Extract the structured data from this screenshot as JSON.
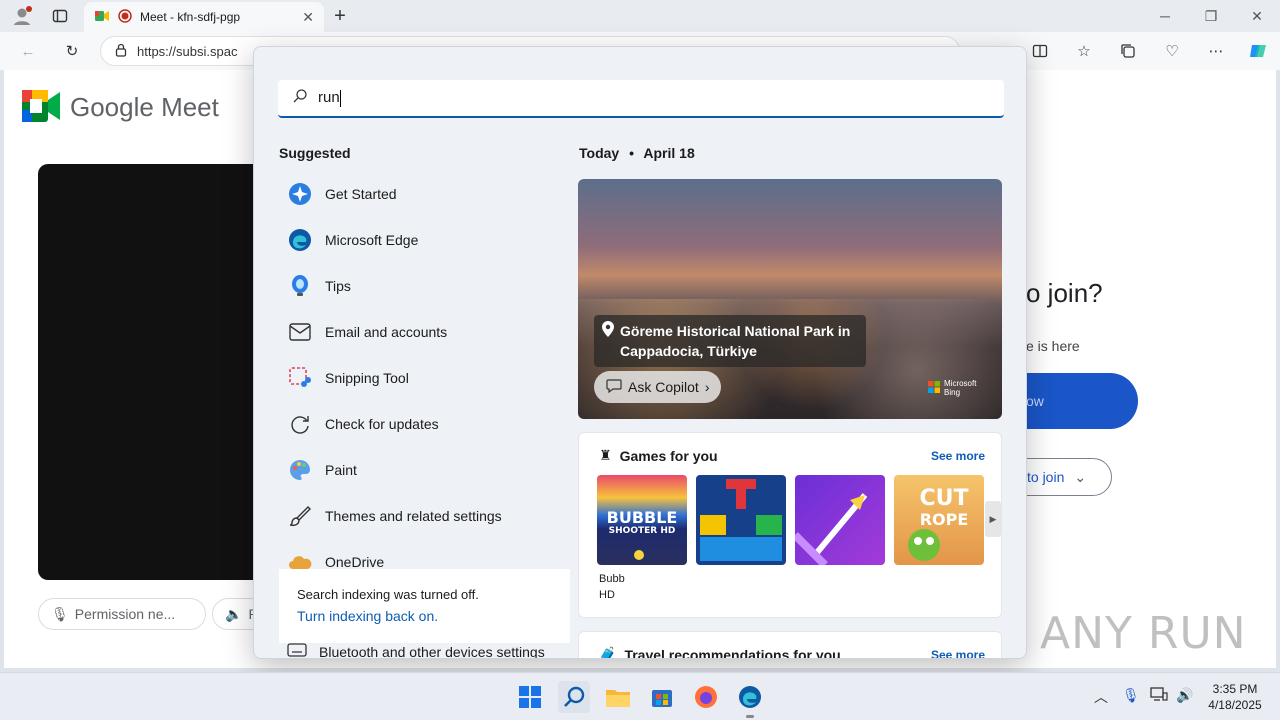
{
  "browser": {
    "tab_title": "Meet - kfn-sdfj-pgp",
    "address": "https://subsi.spac",
    "new_tab_label": "+"
  },
  "meet": {
    "logo_text": "Google Meet",
    "join_question": "o join?",
    "join_subtext": "e is here",
    "join_button": "ow",
    "other_button": "to join",
    "permission_pill": "Permission ne...",
    "pill2": "P"
  },
  "search": {
    "query": "run",
    "suggested_heading": "Suggested",
    "suggested": [
      {
        "label": "Get Started",
        "icon": "get-started-icon"
      },
      {
        "label": "Microsoft Edge",
        "icon": "edge-icon"
      },
      {
        "label": "Tips",
        "icon": "tips-icon"
      },
      {
        "label": "Email and accounts",
        "icon": "mail-icon"
      },
      {
        "label": "Snipping Tool",
        "icon": "snipping-tool-icon"
      },
      {
        "label": "Check for updates",
        "icon": "refresh-icon"
      },
      {
        "label": "Paint",
        "icon": "paint-icon"
      },
      {
        "label": "Themes and related settings",
        "icon": "brush-icon"
      },
      {
        "label": "OneDrive",
        "icon": "onedrive-icon"
      }
    ],
    "indexing_notice": "Search indexing was turned off.",
    "indexing_link": "Turn indexing back on.",
    "bluetooth_item": "Bluetooth and other devices settings",
    "today": "Today",
    "date": "April 18",
    "hero_caption": "Göreme Historical National Park in Cappadocia, Türkiye",
    "ask_copilot": "Ask Copilot",
    "bing_label_1": "Microsoft",
    "bing_label_2": "Bing",
    "games_heading": "Games for you",
    "games_see_more": "See more",
    "game_label_1": "Bubb",
    "game_label_2": "HD",
    "travel_heading": "Travel recommendations for you",
    "travel_see_more": "See more"
  },
  "watermark": "ANY RUN",
  "taskbar": {
    "time": "3:35 PM",
    "date": "4/18/2025"
  },
  "colors": {
    "accent": "#0f5aa8",
    "meet_blue": "#1a56c8"
  }
}
